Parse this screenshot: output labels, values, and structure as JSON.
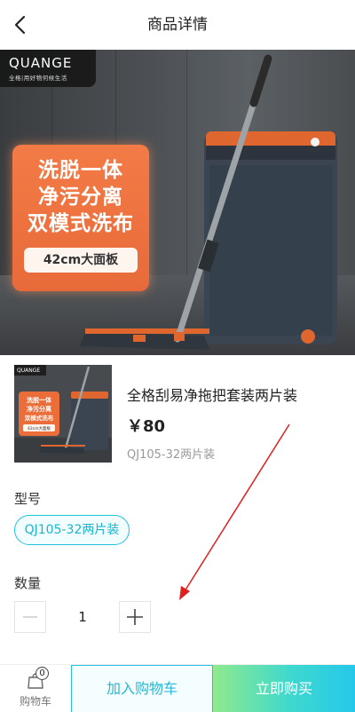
{
  "header": {
    "title": "商品详情",
    "back_icon": "chevron-left-icon"
  },
  "hero": {
    "brand": {
      "name": "QUANGE",
      "tagline": "全格|用好物何候生活"
    },
    "promo_lines": [
      "洗脱一体",
      "净污分离",
      "双模式洗布"
    ],
    "promo_pill": "42cm大面板",
    "accent_color": "#e86a3a"
  },
  "thumbnail": {
    "brand": "QUANGE",
    "promo_lines": [
      "洗脱一体",
      "净污分离",
      "双模式洗布"
    ],
    "promo_pill": "42cm大面板"
  },
  "product": {
    "name": "全格刮易净拖把套装两片装",
    "price": "￥80",
    "sku": "QJ105-32两片装"
  },
  "model": {
    "label": "型号",
    "options": [
      "QJ105-32两片装"
    ],
    "selected": "QJ105-32两片装",
    "accent_color": "#1fc2da"
  },
  "quantity": {
    "label": "数量",
    "value": "1",
    "minus_icon": "minus-icon",
    "plus_icon": "plus-icon"
  },
  "bottom_bar": {
    "cart_label": "购物车",
    "cart_count": "0",
    "add_to_cart": "加入购物车",
    "buy_now": "立即购买"
  }
}
